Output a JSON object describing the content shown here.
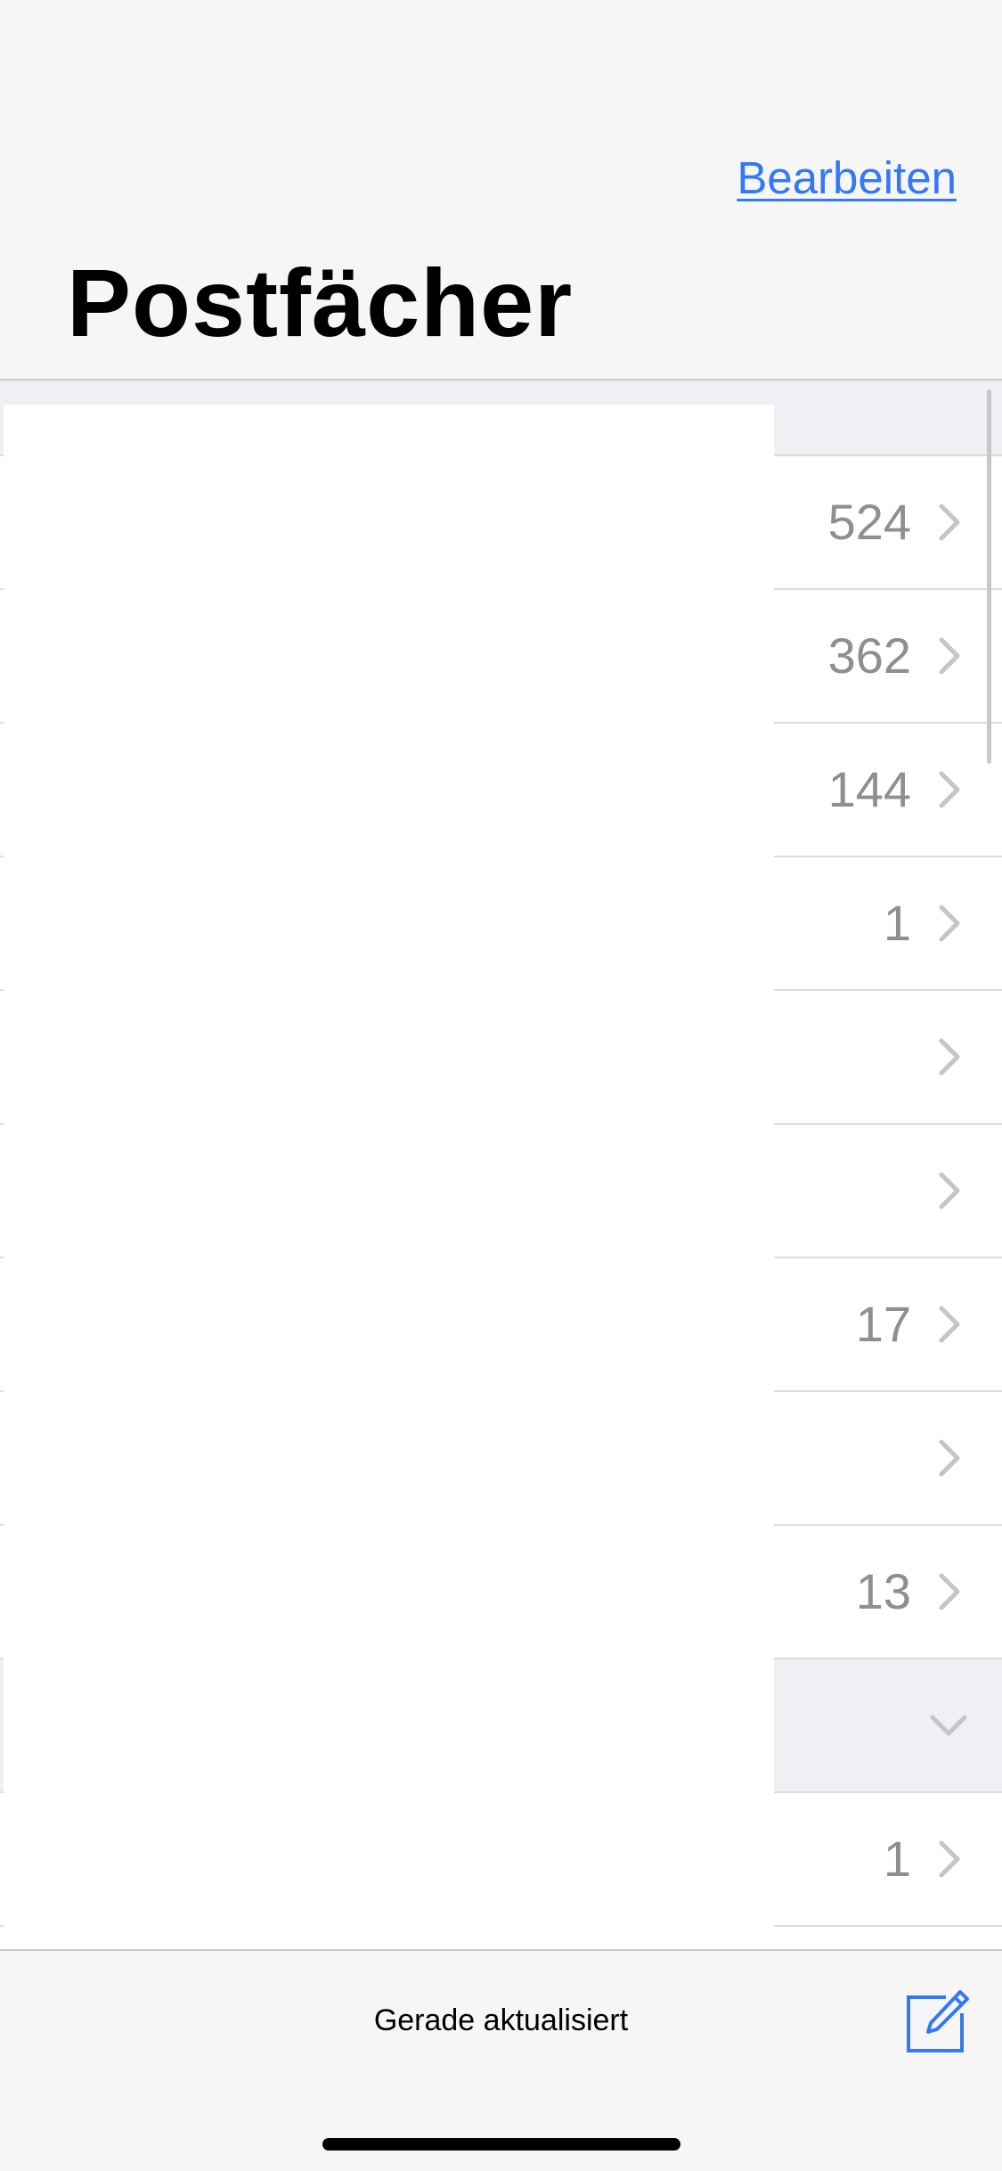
{
  "header": {
    "edit_label": "Bearbeiten",
    "title": "Postfächer"
  },
  "mailboxes": [
    {
      "count": "524",
      "chevron": "chevron-right-icon"
    },
    {
      "count": "362",
      "chevron": "chevron-right-icon"
    },
    {
      "count": "144",
      "chevron": "chevron-right-icon"
    },
    {
      "count": "1",
      "chevron": "chevron-right-icon"
    },
    {
      "count": "",
      "chevron": "chevron-right-icon"
    },
    {
      "count": "",
      "chevron": "chevron-right-icon"
    },
    {
      "count": "17",
      "chevron": "chevron-right-icon"
    },
    {
      "count": "",
      "chevron": "chevron-right-icon"
    },
    {
      "count": "13",
      "chevron": "chevron-right-icon"
    },
    {
      "count": "",
      "chevron": "chevron-down-icon"
    },
    {
      "count": "1",
      "chevron": "chevron-right-icon"
    }
  ],
  "toolbar": {
    "status": "Gerade aktualisiert",
    "compose_icon": "compose-icon"
  },
  "colors": {
    "accent": "#3478f6",
    "background_gray": "#f6f6f7",
    "group_gray": "#efeff4",
    "secondary_text": "#8e8e93",
    "chevron": "#c4c4c9"
  }
}
